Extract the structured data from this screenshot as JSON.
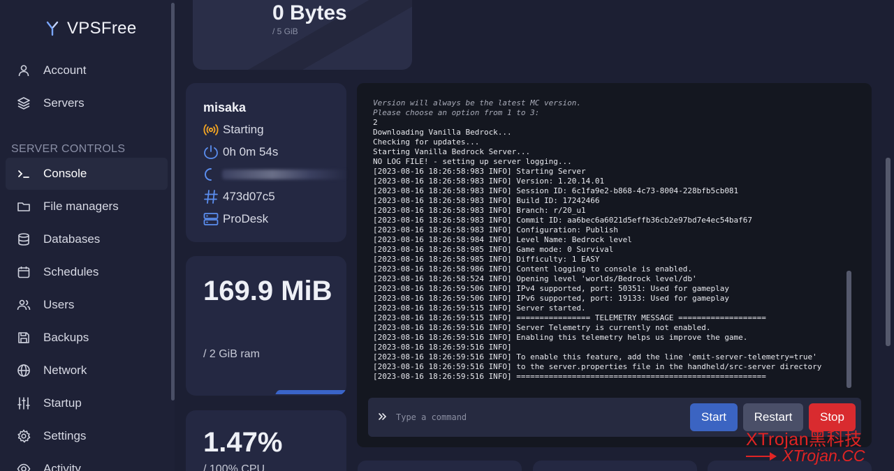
{
  "app": {
    "name": "VPSFree"
  },
  "sidebar": {
    "top_items": [
      {
        "label": "Account",
        "icon": "user-icon"
      },
      {
        "label": "Servers",
        "icon": "layers-icon"
      }
    ],
    "section_label": "SERVER CONTROLS",
    "control_items": [
      {
        "label": "Console",
        "icon": "terminal-icon",
        "active": true
      },
      {
        "label": "File managers",
        "icon": "folder-icon"
      },
      {
        "label": "Databases",
        "icon": "database-icon"
      },
      {
        "label": "Schedules",
        "icon": "calendar-icon"
      },
      {
        "label": "Users",
        "icon": "users-icon"
      },
      {
        "label": "Backups",
        "icon": "save-icon"
      },
      {
        "label": "Network",
        "icon": "globe-icon"
      },
      {
        "label": "Startup",
        "icon": "sliders-icon"
      },
      {
        "label": "Settings",
        "icon": "gear-icon"
      },
      {
        "label": "Activity",
        "icon": "eye-icon"
      }
    ]
  },
  "storage": {
    "value": "0 Bytes",
    "limit": "/ 5 GiB"
  },
  "server_info": {
    "name": "misaka",
    "status": "Starting",
    "uptime": "0h 0m 54s",
    "id": "473d07c5",
    "node": "ProDesk"
  },
  "ram": {
    "value": "169.9 MiB",
    "limit": "/ 2 GiB ram"
  },
  "cpu": {
    "value": "1.47%",
    "limit": "/ 100% CPU"
  },
  "console": {
    "prelude": [
      "Version will always be the latest MC version.",
      "Please choose an option from 1 to 3:"
    ],
    "lines": [
      "2",
      "Downloading Vanilla Bedrock...",
      "Checking for updates...",
      "Starting Vanilla Bedrock Server...",
      "NO LOG FILE! - setting up server logging...",
      "[2023-08-16 18:26:58:983 INFO] Starting Server",
      "[2023-08-16 18:26:58:983 INFO] Version: 1.20.14.01",
      "[2023-08-16 18:26:58:983 INFO] Session ID: 6c1fa9e2-b868-4c73-8004-228bfb5cb081",
      "[2023-08-16 18:26:58:983 INFO] Build ID: 17242466",
      "[2023-08-16 18:26:58:983 INFO] Branch: r/20_u1",
      "[2023-08-16 18:26:58:983 INFO] Commit ID: aa6bec6a6021d5effb36cb2e97bd7e4ec54baf67",
      "[2023-08-16 18:26:58:983 INFO] Configuration: Publish",
      "[2023-08-16 18:26:58:984 INFO] Level Name: Bedrock level",
      "[2023-08-16 18:26:58:985 INFO] Game mode: 0 Survival",
      "[2023-08-16 18:26:58:985 INFO] Difficulty: 1 EASY",
      "[2023-08-16 18:26:58:986 INFO] Content logging to console is enabled.",
      "[2023-08-16 18:26:58:524 INFO] Opening level 'worlds/Bedrock level/db'",
      "[2023-08-16 18:26:59:506 INFO] IPv4 supported, port: 50351: Used for gameplay",
      "[2023-08-16 18:26:59:506 INFO] IPv6 supported, port: 19133: Used for gameplay",
      "[2023-08-16 18:26:59:515 INFO] Server started.",
      "[2023-08-16 18:26:59:515 INFO] ================ TELEMETRY MESSAGE ===================",
      "[2023-08-16 18:26:59:516 INFO] Server Telemetry is currently not enabled.",
      "[2023-08-16 18:26:59:516 INFO] Enabling this telemetry helps us improve the game.",
      "[2023-08-16 18:26:59:516 INFO]",
      "[2023-08-16 18:26:59:516 INFO] To enable this feature, add the line 'emit-server-telemetry=true'",
      "[2023-08-16 18:26:59:516 INFO] to the server.properties file in the handheld/src-server directory",
      "[2023-08-16 18:26:59:516 INFO] ======================================================"
    ],
    "input_placeholder": "Type a command",
    "buttons": {
      "start": "Start",
      "restart": "Restart",
      "stop": "Stop"
    }
  },
  "watermark": {
    "line1": "XTrojan黑科技",
    "line2": "XTrojan.CC"
  },
  "colors": {
    "accent": "#3b64c2",
    "danger": "#d92b2f",
    "status_starting": "#f5a623"
  }
}
